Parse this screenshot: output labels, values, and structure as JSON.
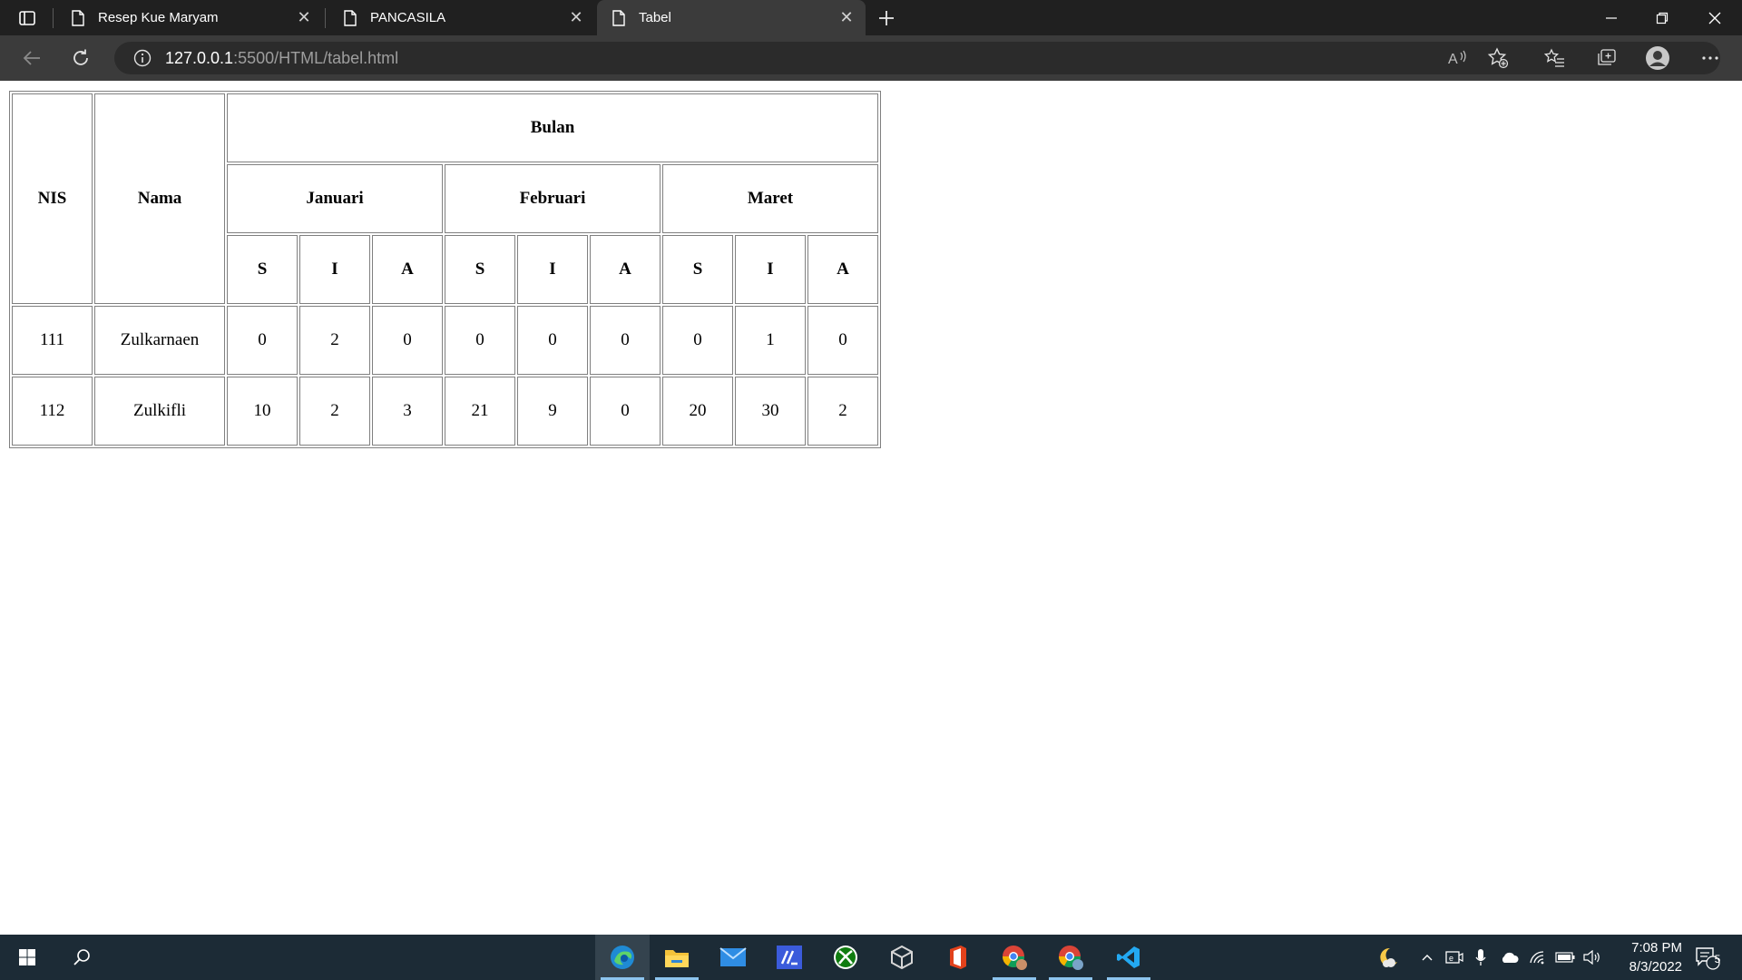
{
  "browser": {
    "tabs": [
      {
        "title": "Resep Kue Maryam",
        "active": false
      },
      {
        "title": "PANCASILA",
        "active": false
      },
      {
        "title": "Tabel",
        "active": true
      }
    ],
    "address": {
      "host": "127.0.0.1",
      "path": ":5500/HTML/tabel.html"
    },
    "icons": {
      "tab_actions": "tab-actions-icon",
      "new_tab": "plus-icon",
      "back": "arrow-left-icon",
      "refresh": "refresh-icon",
      "site_info": "info-icon",
      "read_aloud": "read-aloud-icon",
      "add_favorite": "star-add-icon",
      "favorites": "favorites-list-icon",
      "collections": "collections-icon",
      "profile": "profile-avatar-icon",
      "more": "more-icon"
    }
  },
  "table": {
    "headers": {
      "nis": "NIS",
      "nama": "Nama",
      "bulan": "Bulan",
      "months": [
        "Januari",
        "Februari",
        "Maret"
      ],
      "sub": [
        "S",
        "I",
        "A",
        "S",
        "I",
        "A",
        "S",
        "I",
        "A"
      ]
    },
    "rows": [
      {
        "nis": "111",
        "nama": "Zulkarnaen",
        "values": [
          "0",
          "2",
          "0",
          "0",
          "0",
          "0",
          "0",
          "1",
          "0"
        ]
      },
      {
        "nis": "112",
        "nama": "Zulkifli",
        "values": [
          "10",
          "2",
          "3",
          "21",
          "9",
          "0",
          "20",
          "30",
          "2"
        ]
      }
    ]
  },
  "taskbar": {
    "apps": [
      "windows-start-icon",
      "search-icon",
      "edge-icon",
      "file-explorer-icon",
      "mail-icon",
      "app-icon",
      "xbox-icon",
      "unity-icon",
      "office-icon",
      "chrome-profile-icon",
      "chrome-profile-icon",
      "vscode-icon"
    ],
    "clock": {
      "time": "7:08 PM",
      "date": "8/3/2022"
    },
    "notifications": "5"
  }
}
